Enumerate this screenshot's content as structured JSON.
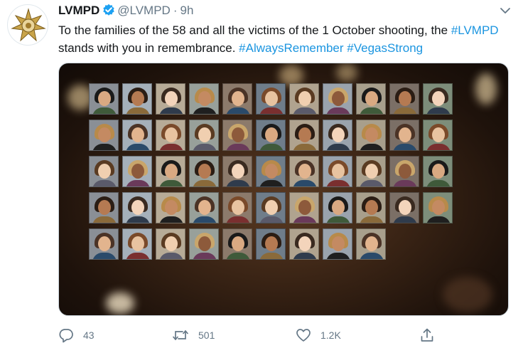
{
  "tweet": {
    "display_name": "LVMPD",
    "handle": "@LVMPD",
    "separator": "·",
    "time": "9h",
    "text_parts": [
      {
        "text": "To the families of the 58 and all the victims of the 1 October shooting, the ",
        "tag": false
      },
      {
        "text": "#LVMPD",
        "tag": true
      },
      {
        "text": " stands with you in remembrance. ",
        "tag": false
      },
      {
        "text": "#AlwaysRemember",
        "tag": true
      },
      {
        "text": " ",
        "tag": false
      },
      {
        "text": "#VegasStrong",
        "tag": true
      }
    ]
  },
  "actions": {
    "reply_count": "43",
    "retweet_count": "501",
    "like_count": "1.2K"
  },
  "icons": {
    "avatar": "police-star-badge-icon",
    "verified": "verified-badge-icon",
    "caret": "chevron-down-icon",
    "reply": "reply-icon",
    "retweet": "retweet-icon",
    "like": "heart-icon",
    "share": "share-icon"
  },
  "colors": {
    "link": "#1b95e0",
    "verified": "#1da1f2",
    "muted": "#657786",
    "badge_gold": "#c9a44a"
  },
  "media": {
    "photo_rows": [
      11,
      11,
      11,
      11,
      9
    ],
    "photo_count": 53
  }
}
